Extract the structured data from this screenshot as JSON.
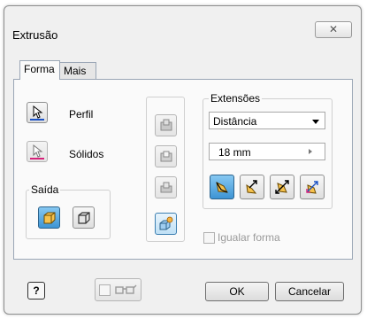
{
  "dialog": {
    "title": "Extrusão",
    "close_glyph": "✕"
  },
  "tabs": [
    {
      "label": "Forma"
    },
    {
      "label": "Mais"
    }
  ],
  "left": {
    "profile_label": "Perfil",
    "solids_label": "Sólidos",
    "output_label": "Saída"
  },
  "extents": {
    "label": "Extensões",
    "type_selected": "Distância",
    "distance_value": "18 mm"
  },
  "match_shape_label": "Igualar forma",
  "footer": {
    "ok_label": "OK",
    "cancel_label": "Cancelar",
    "help_glyph": "?"
  },
  "icons": {
    "profile": "cursor-arrow-icon",
    "solids": "cursor-arrow-icon",
    "output_solid": "solid-cube-icon",
    "output_surface": "surface-cube-icon",
    "operation_join": "join-icon",
    "operation_cut": "cut-icon",
    "operation_intersect": "intersect-icon",
    "new_solid": "new-solid-icon",
    "direction_default": "direction-default-icon",
    "direction_flipped": "direction-flipped-icon",
    "direction_symmetric": "direction-symmetric-icon",
    "direction_asymmetric": "direction-asymmetric-icon",
    "preview": "glasses-icon"
  },
  "colors": {
    "profile_underline": "#1a52c6",
    "solids_underline": "#d6227a",
    "selected_blue": "#3d94d4"
  }
}
